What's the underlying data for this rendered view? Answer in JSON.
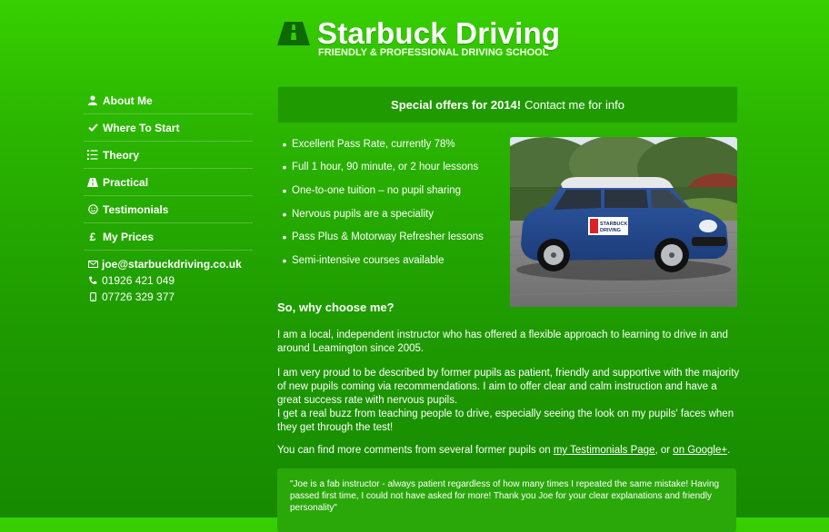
{
  "header": {
    "title": "Starbuck Driving",
    "tagline": "FRIENDLY & PROFESSIONAL DRIVING SCHOOL"
  },
  "nav": {
    "items": [
      {
        "label": "About Me",
        "icon": "user-icon"
      },
      {
        "label": "Where To Start",
        "icon": "check-icon"
      },
      {
        "label": "Theory",
        "icon": "list-icon"
      },
      {
        "label": "Practical",
        "icon": "road-icon"
      },
      {
        "label": "Testimonials",
        "icon": "smile-icon"
      },
      {
        "label": "My Prices",
        "icon": "pound-icon"
      }
    ]
  },
  "contact": {
    "email": "joe@starbuckdriving.co.uk",
    "phone": "01926 421 049",
    "mobile": "07726 329 377"
  },
  "banner": {
    "bold": "Special offers for 2014!",
    "text": "Contact me for info"
  },
  "features": [
    "Excellent Pass Rate, currently 78%",
    "Full 1 hour, 90 minute, or 2 hour lessons",
    "One-to-one tuition – no pupil sharing",
    "Nervous pupils are a speciality",
    "Pass Plus & Motorway Refresher lessons",
    "Semi-intensive courses available"
  ],
  "photo": {
    "car_sign_line1": "STARBUCK",
    "car_sign_line2": "DRIVING"
  },
  "main": {
    "why_heading": "So, why choose me?",
    "para1": "I am a local, independent instructor who has offered a flexible approach to learning to drive in and around Leamington since 2005.",
    "para2": "I am very proud to be described by former pupils as patient, friendly and supportive with the majority of new pupils coming via recommendations. I aim to offer clear and calm instruction and have a great success rate with nervous pupils.",
    "para3": "I get a real buzz from teaching people to drive, especially seeing the look on my pupils' faces when they get through the test!",
    "para4_prefix": "You can find more comments from several former pupils on ",
    "para4_link1": "my Testimonials Page",
    "para4_mid": ", or ",
    "para4_link2": "on Google+",
    "para4_suffix": "."
  },
  "quote": {
    "text": "\"Joe is a fab instructor - always patient regardless of how many times I repeated the same mistake! Having passed first time, I could not have asked for more! Thank you Joe for your clear explanations and friendly personality\""
  },
  "colors": {
    "background_top": "#37d000",
    "background_bottom": "#168a00",
    "banner_bg": "#1f9a00"
  }
}
